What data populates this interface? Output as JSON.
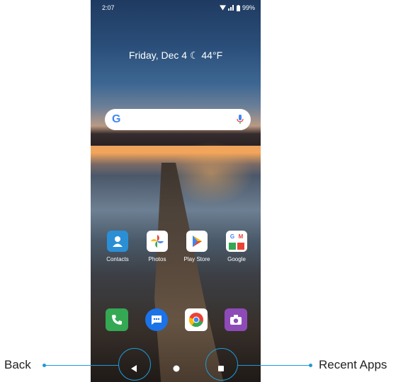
{
  "status": {
    "time": "2:07",
    "battery": "99%"
  },
  "home": {
    "date_weather": "Friday, Dec 4 ☾ 44°F"
  },
  "search": {
    "logo": "G"
  },
  "apps": [
    {
      "label": "Contacts",
      "icon": "contacts-icon",
      "color": "#2b8fd6"
    },
    {
      "label": "Photos",
      "icon": "photos-icon",
      "color": "#ffffff"
    },
    {
      "label": "Play Store",
      "icon": "play-store-icon",
      "color": "#ffffff"
    },
    {
      "label": "Google",
      "icon": "google-folder-icon",
      "color": "#ffffff"
    }
  ],
  "dock": [
    {
      "icon": "phone-icon",
      "color": "#34a853"
    },
    {
      "icon": "messages-icon",
      "color": "#1a73e8"
    },
    {
      "icon": "chrome-icon",
      "color": "#ffffff"
    },
    {
      "icon": "camera-icon",
      "color": "#8e4bb8"
    }
  ],
  "callouts": {
    "back": "Back",
    "recent": "Recent Apps"
  },
  "colors": {
    "accent": "#1e9ad6"
  }
}
